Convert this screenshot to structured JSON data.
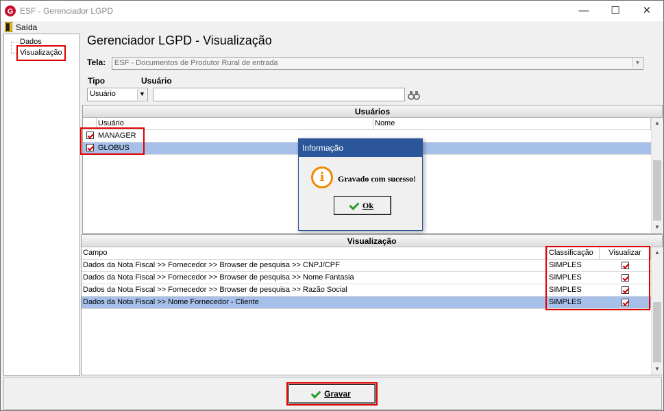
{
  "window": {
    "title": "ESF - Gerenciador LGPD",
    "minimize_glyph": "—",
    "maximize_glyph": "☐",
    "close_glyph": "✕",
    "app_icon": "esf-logo-icon"
  },
  "menu": {
    "exit_label": "Saída",
    "exit_icon": "door-exit-icon"
  },
  "tree": {
    "items": [
      {
        "label": "Dados"
      },
      {
        "label": "Visualização",
        "selected": true
      }
    ]
  },
  "main": {
    "title": "Gerenciador LGPD - Visualização",
    "screen_label": "Tela:",
    "screen_value": "ESF - Documentos de Produtor Rural de entrada",
    "type_label": "Tipo",
    "type_value": "Usuário",
    "user_label": "Usuário",
    "user_value": "",
    "search_icon": "binoculars-icon"
  },
  "users_grid": {
    "caption": "Usuários",
    "columns": [
      "Usuário",
      "Nome"
    ],
    "rows": [
      {
        "user": "MANAGER",
        "name": "",
        "checked": true
      },
      {
        "user": "GLOBUS",
        "name": "",
        "checked": true,
        "selected": true
      }
    ]
  },
  "view_grid": {
    "caption": "Visualização",
    "columns": [
      "Campo",
      "Classificação",
      "Visualizar"
    ],
    "rows": [
      {
        "field": "Dados da Nota Fiscal  >>  Fornecedor >> Browser de pesquisa >> CNPJ/CPF",
        "class": "SIMPLES",
        "view": true
      },
      {
        "field": "Dados da Nota Fiscal  >>  Fornecedor >> Browser de pesquisa >> Nome Fantasia",
        "class": "SIMPLES",
        "view": true
      },
      {
        "field": "Dados da Nota Fiscal  >>  Fornecedor >> Browser de pesquisa >> Razão Social",
        "class": "SIMPLES",
        "view": true
      },
      {
        "field": "Dados da Nota Fiscal >> Nome Fornecedor - Cliente",
        "class": "SIMPLES",
        "view": true,
        "selected": true
      }
    ]
  },
  "dialog": {
    "title": "Informação",
    "message": "Gravado com sucesso!",
    "ok_label": "Ok",
    "icon": "info-icon"
  },
  "footer": {
    "save_label": "Gravar"
  },
  "colors": {
    "highlight": "#e00000",
    "selection": "#a6c0ea",
    "dialog_title": "#2b579a"
  }
}
